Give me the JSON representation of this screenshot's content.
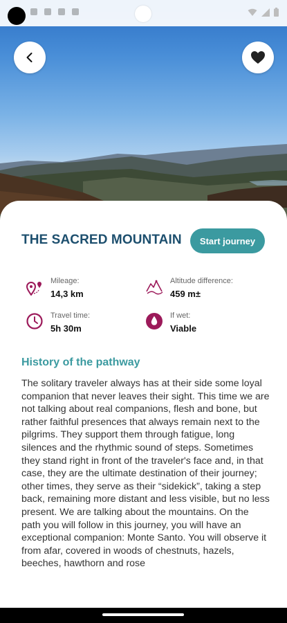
{
  "hero": {
    "back_icon": "chevron-left-icon",
    "favorite_icon": "heart-icon"
  },
  "route": {
    "title": "THE SACRED MOUNTAIN",
    "start_label": "Start journey"
  },
  "stats": [
    {
      "icon": "map-pins-icon",
      "label": "Mileage:",
      "value": "14,3 km"
    },
    {
      "icon": "altitude-icon",
      "label": "Altitude difference:",
      "value": "459 m±"
    },
    {
      "icon": "clock-icon",
      "label": "Travel time:",
      "value": "5h 30m"
    },
    {
      "icon": "water-drop-icon",
      "label": "If wet:",
      "value": "Viable"
    }
  ],
  "history": {
    "title": "History of the pathway",
    "body": "The solitary traveler always has at their side some loyal companion that never leaves their sight. This time we are not talking about real companions, flesh and bone, but rather faithful presences that always remain next to the pilgrims. They support them through fatigue, long silences and the rhythmic sound of steps. Sometimes they stand right in front of the traveler's face and, in that case, they are the ultimate destination of their journey; other times, they serve as their “sidekick”, taking a step back, remaining more distant and less visible, but no less present. We are talking about the mountains. On the path you will follow in this journey, you will have an exceptional companion: Monte Santo. You will observe it from afar, covered in woods of chestnuts, hazels, beeches, hawthorn and rose"
  },
  "colors": {
    "title": "#1d4f6e",
    "accent": "#3b9aa0",
    "icon": "#9c1a5a"
  }
}
